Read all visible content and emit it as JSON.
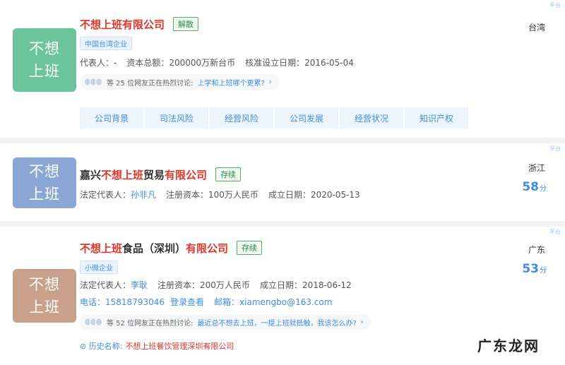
{
  "companies": [
    {
      "logo_line1": "不想",
      "logo_line2": "上班",
      "logo_color": "#6cc49a",
      "title_parts": [
        "不想上班有限公司"
      ],
      "status": "解散",
      "tag": "中国台湾企业",
      "info": [
        "代表人：-",
        "资本总额：200000万新台币",
        "核准设立日期：2016-05-04"
      ],
      "discuss_text": "等 25 位网友正在热烈讨论:",
      "discuss_question": "上学和上班哪个更累?",
      "tabs": [
        "公司背景",
        "司法风险",
        "经营风险",
        "公司发展",
        "经营状况",
        "知识产权"
      ],
      "province": "台湾"
    },
    {
      "logo_line1": "不想",
      "logo_line2": "上班",
      "logo_color": "#8aa6d4",
      "title_pre": "嘉兴",
      "title_hl1": "不想上班",
      "title_mid": "贸易",
      "title_hl2": "有限公司",
      "status": "存续",
      "info_label": "法定代表人：",
      "info_link": "孙非凡",
      "info_rest": [
        "注册资本：100万人民币",
        "成立日期：2020-05-13"
      ],
      "province": "浙江",
      "score": "58",
      "score_unit": "分"
    },
    {
      "logo_line1": "不想",
      "logo_line2": "上班",
      "logo_color": "#c9a08a",
      "title_hl1": "不想上班",
      "title_mid": "食品（深圳）",
      "title_hl2": "有限公司",
      "status": "存续",
      "tag": "小微企业",
      "info_label": "法定代表人：",
      "info_link": "李耿",
      "info_rest": [
        "注册资本：200万人民币",
        "成立日期：2018-06-12"
      ],
      "phone_label": "电话：",
      "phone": "15818793046",
      "phone_link": "登录查看",
      "email_label": "邮箱：",
      "email": "xiamengbo@163.com",
      "discuss_text": "等 52 位网友正在热烈讨论:",
      "discuss_question": "最近总不想去上班，一提上班就抵触，我该怎么办?",
      "history_label": "历史名称:",
      "history_value": "不想上班餐饮管理深圳有限公司",
      "province": "广东",
      "score": "53",
      "score_unit": "分"
    }
  ],
  "corner_text": "平台",
  "watermark": "广东龙网"
}
